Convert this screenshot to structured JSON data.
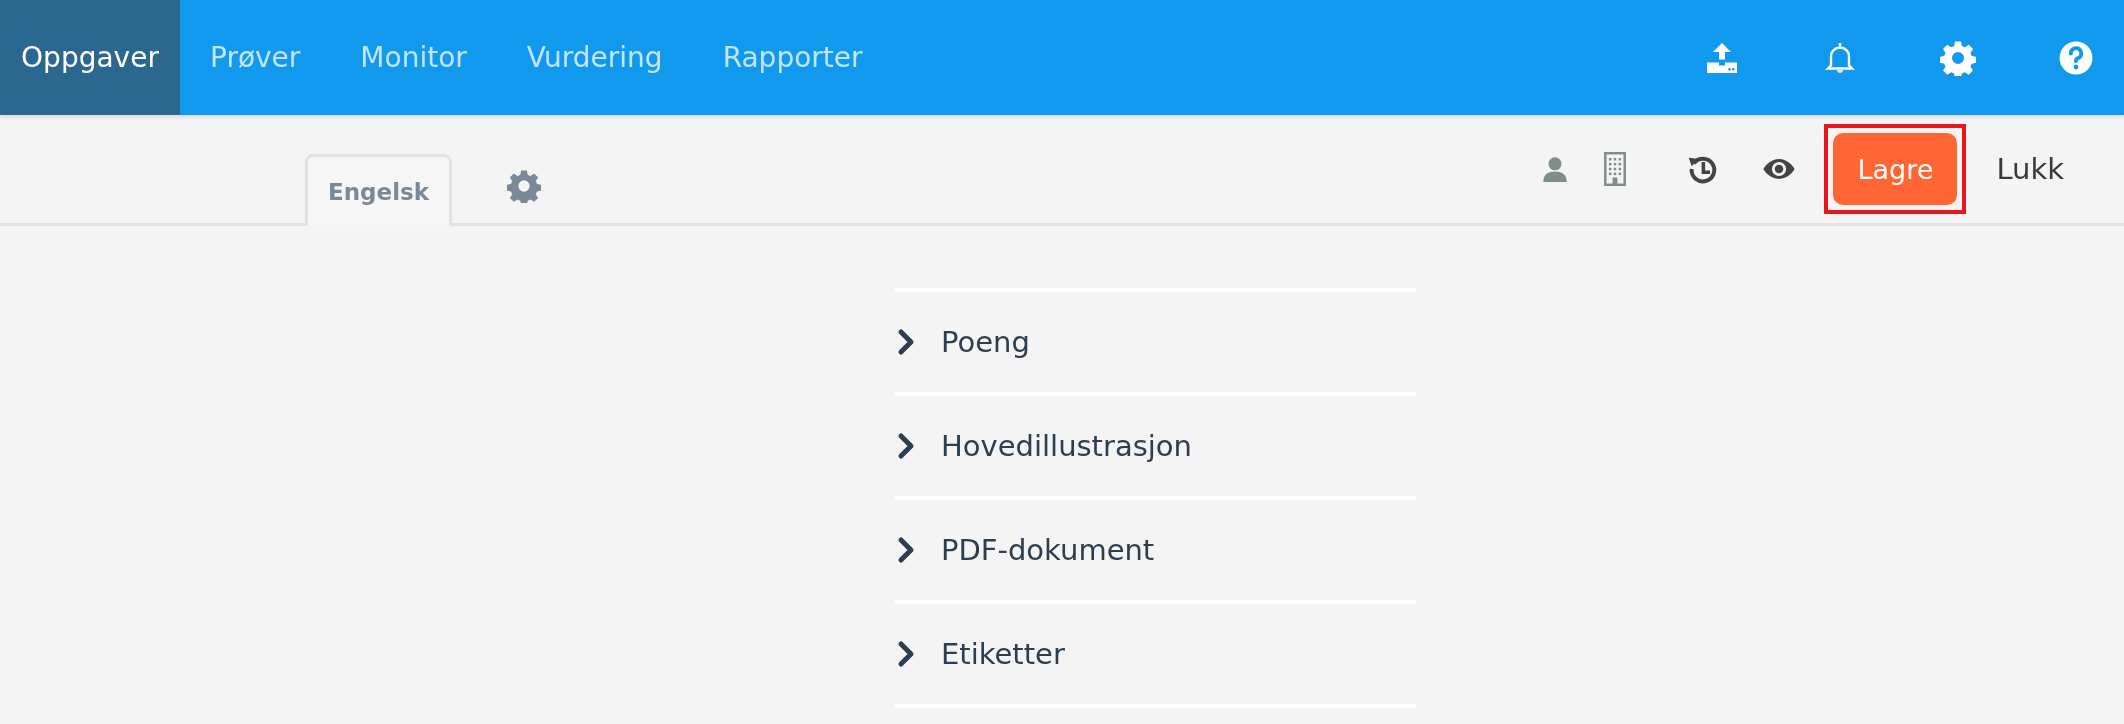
{
  "nav": {
    "items": [
      {
        "label": "Oppgaver",
        "selected": true
      },
      {
        "label": "Prøver",
        "selected": false
      },
      {
        "label": "Monitor",
        "selected": false
      },
      {
        "label": "Vurdering",
        "selected": false
      },
      {
        "label": "Rapporter",
        "selected": false
      }
    ]
  },
  "toolbar": {
    "tabs": [
      {
        "label": "Engelsk",
        "selected": true
      }
    ],
    "save_button": {
      "label": "Lagre",
      "highlighted": true
    },
    "close_link": {
      "label": "Lukk"
    }
  },
  "sections": [
    {
      "label": "Poeng",
      "expanded": false
    },
    {
      "label": "Hovedillustrasjon",
      "expanded": false
    },
    {
      "label": "PDF-dokument",
      "expanded": false
    },
    {
      "label": "Etiketter",
      "expanded": false
    }
  ]
}
